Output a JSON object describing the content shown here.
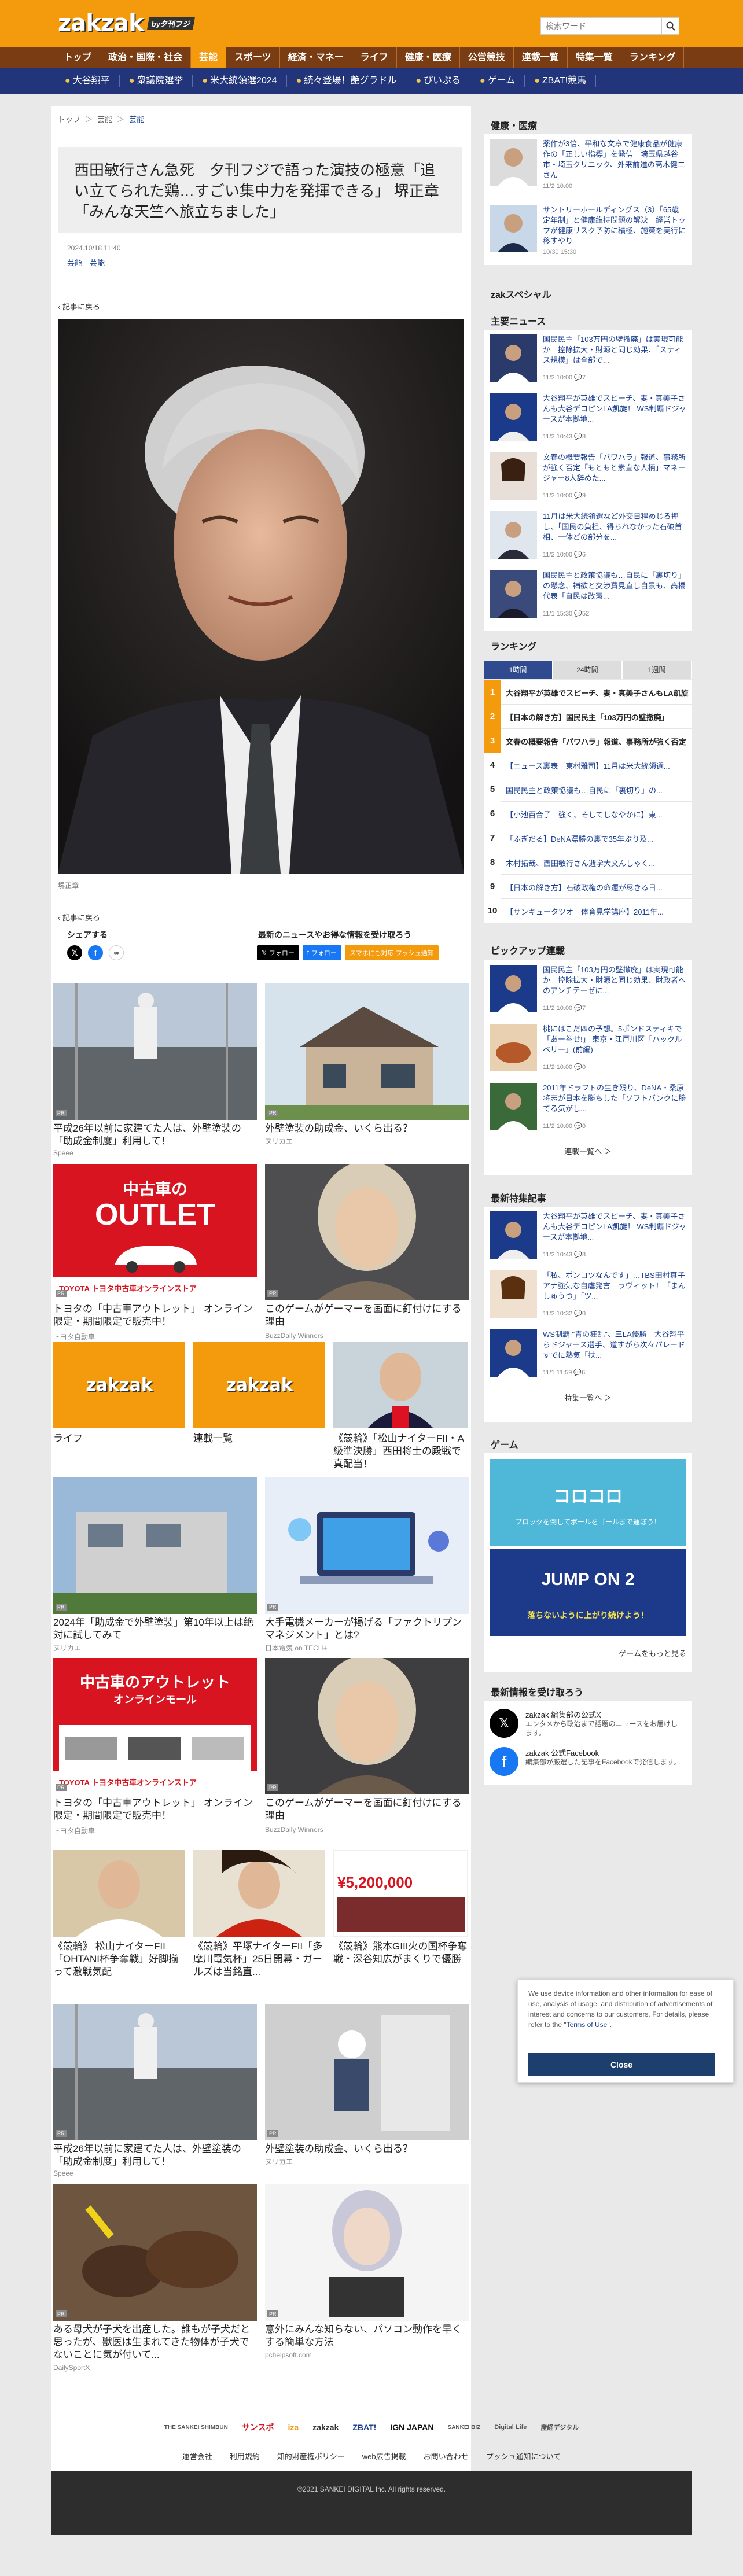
{
  "header": {
    "logo": "zakzak",
    "logo_sub": "by夕刊フジ",
    "search_placeholder": "検索ワード"
  },
  "gnav": [
    "トップ",
    "政治・国際・社会",
    "芸能",
    "スポーツ",
    "経済・マネー",
    "ライフ",
    "健康・医療",
    "公営競技",
    "連載一覧",
    "特集一覧",
    "ランキング"
  ],
  "gnav_active": 2,
  "tnav": [
    "大谷翔平",
    "衆議院選挙",
    "米大統領選2024",
    "続々登場！艶グラドル",
    "ぴいぷる",
    "ゲーム",
    "ZBAT!競馬"
  ],
  "article": {
    "breadcrumb": [
      "トップ",
      "芸能",
      "芸能"
    ],
    "title": "西田敏行さん急死　夕刊フジで語った演技の極意「追い立てられた鶏…すごい集中力を発揮できる」 堺正章「みんな天竺へ旅立ちました」",
    "date": "2024.10/18 11:40",
    "category": "芸能｜芸能",
    "back": "記事に戻る",
    "caption": "堺正章",
    "share_label": "シェアする",
    "follow_label": "最新のニュースやお得な情報を受け取ろう",
    "follow_x": "フォロー",
    "follow_fb": "フォロー",
    "follow_push": "スマホにも対応 プッシュ通知"
  },
  "tiles": [
    {
      "title": "平成26年以前に家建てた人は、外壁塗装の「助成金制度」利用して！",
      "source": "Speee"
    },
    {
      "title": "外壁塗装の助成金、いくら出る？",
      "source": "ヌリカエ"
    },
    {
      "title": "トヨタの「中古車アウトレット」 オンライン限定・期間限定で販売中！",
      "source": "トヨタ自動車",
      "banner": "中古車の",
      "banner2": "OUTLET",
      "brand": "TOYOTA トヨタ中古車オンラインストア"
    },
    {
      "title": "このゲームがゲーマーを画面に釘付けにする理由",
      "source": "BuzzDaily Winners"
    },
    {
      "title": "ライフ",
      "source": ""
    },
    {
      "title": "連載一覧",
      "source": ""
    },
    {
      "title": "《競輪》「松山ナイターFII・A級準決勝」西田将士の殿戦で真配当！",
      "source": ""
    },
    {
      "title": "2024年「助成金で外壁塗装」第10年以上は絶対に試してみて",
      "source": "ヌリカエ"
    },
    {
      "title": "大手電機メーカーが掲げる「ファクトリプンマネジメント」とは?",
      "source": "日本電気 on TECH+"
    },
    {
      "title": "トヨタの「中古車アウトレット」 オンライン限定・期間限定で販売中！",
      "source": "トヨタ自動車",
      "banner": "中古車のアウトレット",
      "banner2": "オンラインモール",
      "brand": "TOYOTA トヨタ中古車オンラインストア"
    },
    {
      "title": "このゲームがゲーマーを画面に釘付けにする理由",
      "source": "BuzzDaily Winners"
    },
    {
      "title": "《競輪》 松山ナイターFII「OHTANI杯争奪戦」好脚揃って激戦気配",
      "source": ""
    },
    {
      "title": "《競輪》平塚ナイターFII「多摩川電気杯」25日開幕・ガールズは当銘直...",
      "source": ""
    },
    {
      "title": "《競輪》熊本GIII火の国杯争奪戦・深谷知広がまくりで優勝",
      "source": "",
      "money": "¥5,200,000"
    },
    {
      "title": "平成26年以前に家建てた人は、外壁塗装の「助成金制度」利用して！",
      "source": "Speee"
    },
    {
      "title": "外壁塗装の助成金、いくら出る？",
      "source": "ヌリカエ"
    },
    {
      "title": "ある母犬が子犬を出産した。誰もが子犬だと思ったが、獣医は生まれてきた物体が子犬でないことに気が付いて...",
      "source": "DailySportX"
    },
    {
      "title": "意外にみんな知らない、パソコン動作を早くする簡単な方法",
      "source": "pchelpsoft.com"
    }
  ],
  "sidebar": {
    "health_title": "健康・医療",
    "health": [
      {
        "text": "薬作が3倍、平和な文章で健康食品が健康作の「正しい指標」を発信　埼玉県越谷市・埼玉クリニック、外来前進の高木健二さん",
        "time": "11/2 10:00"
      },
      {
        "text": "サントリーホールディングス（3）「65歳定年制」と健康維持問題の解決　経営トップが健康リスク予防に積極、施策を実行に移すやり",
        "time": "10/30 15:30"
      }
    ],
    "special_title": "zakスペシャル",
    "main_news_title": "主要ニュース",
    "main_news": [
      {
        "text": "国民民主「103万円の壁撤廃」は実現可能か　控除拡大・財源と同じ効果、「スティス規模」は全部で...",
        "time": "11/2 10:00",
        "count": "7"
      },
      {
        "text": "大谷翔平が英雄でスピーチ、妻・真美子さんも大谷デコピンLA凱旋！ WS制覇ドジャースが本拠地...",
        "time": "11/2 10:43",
        "count": "8"
      },
      {
        "text": "文春の概要報告「パワハラ」報道、事務所が強く否定「もともと素直な人柄」マネージャー8人辞めた...",
        "time": "11/2 10:00",
        "count": "9"
      },
      {
        "text": "11月は米大統領選など外交日程めじろ押し、「国民の負担、得られなかった石破首相、一体どの部分を...",
        "time": "11/2 10:00",
        "count": "6"
      },
      {
        "text": "国民民主と政策協議も…自民に「裏切り」の懸念、補欲と交渉費見直し自景も、高橋代表「自民は改憲...",
        "time": "11/1 15:30",
        "count": "52"
      }
    ],
    "ranking_title": "ランキング",
    "ranking_tabs": [
      "1時間",
      "24時間",
      "1週間"
    ],
    "ranking": [
      "大谷翔平が英雄でスピーチ、妻・真美子さんもLA凱旋",
      "【日本の解き方】国民民主「103万円の壁撤廃」",
      "文春の概要報告「パワハラ」報道、事務所が強く否定",
      "【ニュース裏表　東村雅司】11月は米大統領選...",
      "国民民主と政策協議も…自民に「裏切り」の...",
      "【小池百合子　強く、そしてしなやかに】東...",
      "「ふぎだる】DeNA漂勝の裏で35年ぶり及...",
      "木村拓哉、西田敏行さん逝学大文んしゃく...",
      "【日本の解き方】石破政権の命運が尽きる日...",
      "【サンキュータツオ　体育見学講座】2011年..."
    ],
    "pickup_title": "ピックアップ連載",
    "pickup": [
      {
        "text": "国民民主「103万円の壁撤廃」は実現可能か　控除拡大・財源と同じ効果、財政者へのアンチテーゼに...",
        "time": "11/2 10:00",
        "count": "7"
      },
      {
        "text": "桃にはこだ四の予想。5ポンドスティキで「あー拳せ!」 東京・江戸川区「ハックルベリー」(前編)",
        "time": "11/2 10:00",
        "count": "0"
      },
      {
        "text": "2011年ドラフトの生き残り、DeNA・桑原将志が日本を勝ちした「ソフトバンクに勝てる気がし...",
        "time": "11/2 10:00",
        "count": "0"
      }
    ],
    "pickup_more": "連載一覧へ ＞",
    "feature_title": "最新特集記事",
    "feature": [
      {
        "text": "大谷翔平が英雄でスピーチ、妻・真美子さんも大谷デコピンLA凱旋！ WS制覇ドジャースが本拠地...",
        "time": "11/2 10:43",
        "count": "8"
      },
      {
        "text": "「私、ポンコツなんです」…TBS田村真子アナ強気な自虐発言　ラヴィット！「まんしゅうつ」「ツ...",
        "time": "11/2 10:32",
        "count": "0"
      },
      {
        "text": "WS制覇 \"青の狂乱\"、三LA優勝　大谷翔平らドジャース選手、道すがら次々パレード　すでに熱気「扶...",
        "time": "11/1 11:59",
        "count": "6"
      }
    ],
    "feature_more": "特集一覧へ ＞",
    "game_title": "ゲーム",
    "game1": "コロコロ",
    "game1_sub": "ブロックを倒してボールをゴールまで運ぼう！",
    "game2": "JUMP ON 2",
    "game2_sub": "落ちないように上がり続けよう！",
    "game_more": "ゲームをもっと見る",
    "follow_title": "最新情報を受け取ろう",
    "follow": [
      {
        "name": "zakzak 編集部の公式X",
        "desc": "エンタメから政治まで話題のニュースをお届けします。"
      },
      {
        "name": "zakzak 公式Facebook",
        "desc": "編集部が厳選した記事をFacebookで発信します。"
      }
    ]
  },
  "footer": {
    "logos": [
      "THE SANKEI SHIMBUN",
      "サンスポ",
      "iza",
      "zakzak",
      "ZBAT!",
      "IGN JAPAN",
      "SANKEI BIZ",
      "Digital Life",
      "産経デジタル"
    ],
    "links": [
      "運営会社",
      "利用規約",
      "知的財産権ポリシー",
      "web広告掲載",
      "お問い合わせ",
      "プッシュ通知について"
    ],
    "copyright": "©2021 SANKEI DIGITAL Inc. All rights reserved."
  },
  "cookie": {
    "text": "We use device information and other information for ease of use, analysis of usage, and distribution of advertisements of interest and concerns to our customers. For details, please refer to the",
    "link": "Terms of Use",
    "close": "Close"
  },
  "colors": {
    "brand_orange": "#f39a0d",
    "nav_brown": "#7a3c12",
    "nav_blue": "#22357a",
    "link_blue": "#1a3f8f"
  }
}
